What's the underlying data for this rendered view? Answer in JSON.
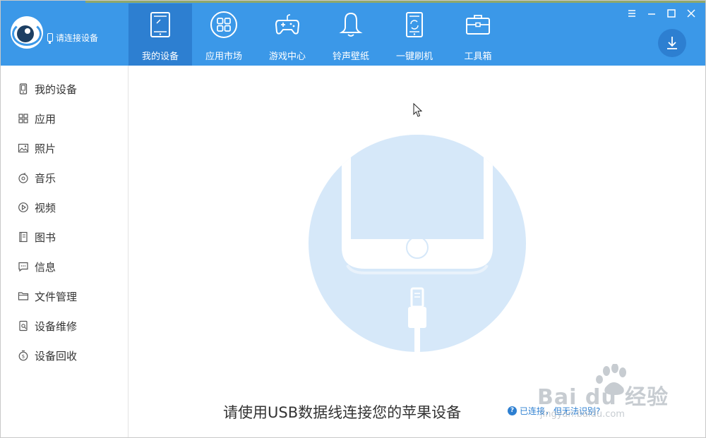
{
  "header": {
    "connect_status": "请连接设备",
    "nav": [
      {
        "label": "我的设备",
        "icon": "tablet-icon",
        "active": true
      },
      {
        "label": "应用市场",
        "icon": "apps-grid-icon",
        "active": false
      },
      {
        "label": "游戏中心",
        "icon": "gamepad-icon",
        "active": false
      },
      {
        "label": "铃声壁纸",
        "icon": "bell-icon",
        "active": false
      },
      {
        "label": "一键刷机",
        "icon": "phone-refresh-icon",
        "active": false
      },
      {
        "label": "工具箱",
        "icon": "toolbox-icon",
        "active": false
      }
    ],
    "window_controls": [
      "menu-icon",
      "minimize-icon",
      "maximize-icon",
      "close-icon"
    ],
    "download_icon": "download-icon"
  },
  "sidebar": {
    "items": [
      {
        "label": "我的设备",
        "icon": "phone-icon"
      },
      {
        "label": "应用",
        "icon": "grid-icon"
      },
      {
        "label": "照片",
        "icon": "image-icon"
      },
      {
        "label": "音乐",
        "icon": "music-icon"
      },
      {
        "label": "视频",
        "icon": "play-icon"
      },
      {
        "label": "图书",
        "icon": "book-icon"
      },
      {
        "label": "信息",
        "icon": "message-icon"
      },
      {
        "label": "文件管理",
        "icon": "folder-icon"
      },
      {
        "label": "设备维修",
        "icon": "repair-icon"
      },
      {
        "label": "设备回收",
        "icon": "recycle-icon"
      }
    ]
  },
  "main": {
    "headline": "请使用USB数据线连接您的苹果设备",
    "help_text": "已连接，但无法识别?"
  },
  "watermark": {
    "brand": "Bai du 经验",
    "url": "jingyan.baidu.com"
  },
  "colors": {
    "header_bg": "#3b98e8",
    "active_tab": "#2d7fd1",
    "illustration_bg": "#d6e8f9"
  }
}
